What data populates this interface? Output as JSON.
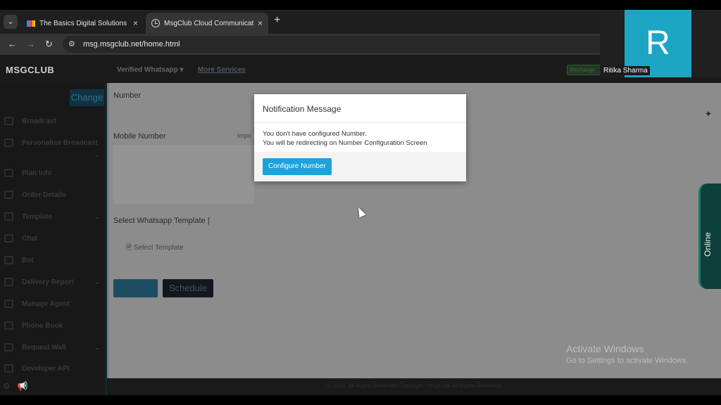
{
  "browser": {
    "tabs": [
      {
        "title": "The Basics Digital Solutions Pvt",
        "active": false
      },
      {
        "title": "MsgClub Cloud Communicatio",
        "active": true
      }
    ],
    "new_tab": "+",
    "tab_close": "×",
    "url": "msg.msgclub.net/home.html"
  },
  "header": {
    "brand": "MSGCLUB",
    "nav_verified": "Verified Whatsapp ▾",
    "nav_more": "More Services",
    "recharge": "Recharge"
  },
  "sidebar": {
    "change_label": "Change",
    "items": [
      {
        "label": "Broadcast",
        "chevron": ""
      },
      {
        "label": "Personalise Broadcast",
        "chevron": ""
      },
      {
        "label": "Plan Info",
        "chevron": ""
      },
      {
        "label": "Order Details",
        "chevron": ""
      },
      {
        "label": "Template",
        "chevron": "⌄"
      },
      {
        "label": "Chat",
        "chevron": ""
      },
      {
        "label": "Bot",
        "chevron": ""
      },
      {
        "label": "Delivery Report",
        "chevron": "⌄"
      },
      {
        "label": "Manage Agent",
        "chevron": ""
      },
      {
        "label": "Phone Book",
        "chevron": ""
      },
      {
        "label": "Request Wall",
        "chevron": "⌄"
      },
      {
        "label": "Developer API",
        "chevron": ""
      }
    ]
  },
  "main": {
    "number_label": "Number",
    "mobile_label": "Mobile Number",
    "import_label": "Impo",
    "template_label": "Select Whatsapp Template |",
    "select_template": "Select Template",
    "now_label": "Now",
    "schedule_label": "Schedule"
  },
  "modal": {
    "title": "Notification Message",
    "line1": "You don't have configured Number.",
    "line2": "You will be redirecting on Number Configuration Screen",
    "button": "Configure Number"
  },
  "footer": {
    "text": "© 2023. All Rights Reserved Copyright - MsgClub All Rights Reserved"
  },
  "online_tab": "Online",
  "video_call": {
    "initial": "R",
    "name": "Ritika Sharma",
    "tile_color": "#1da5c4"
  },
  "watermark": {
    "line1": "Activate Windows",
    "line2": "Go to Settings to activate Windows."
  }
}
